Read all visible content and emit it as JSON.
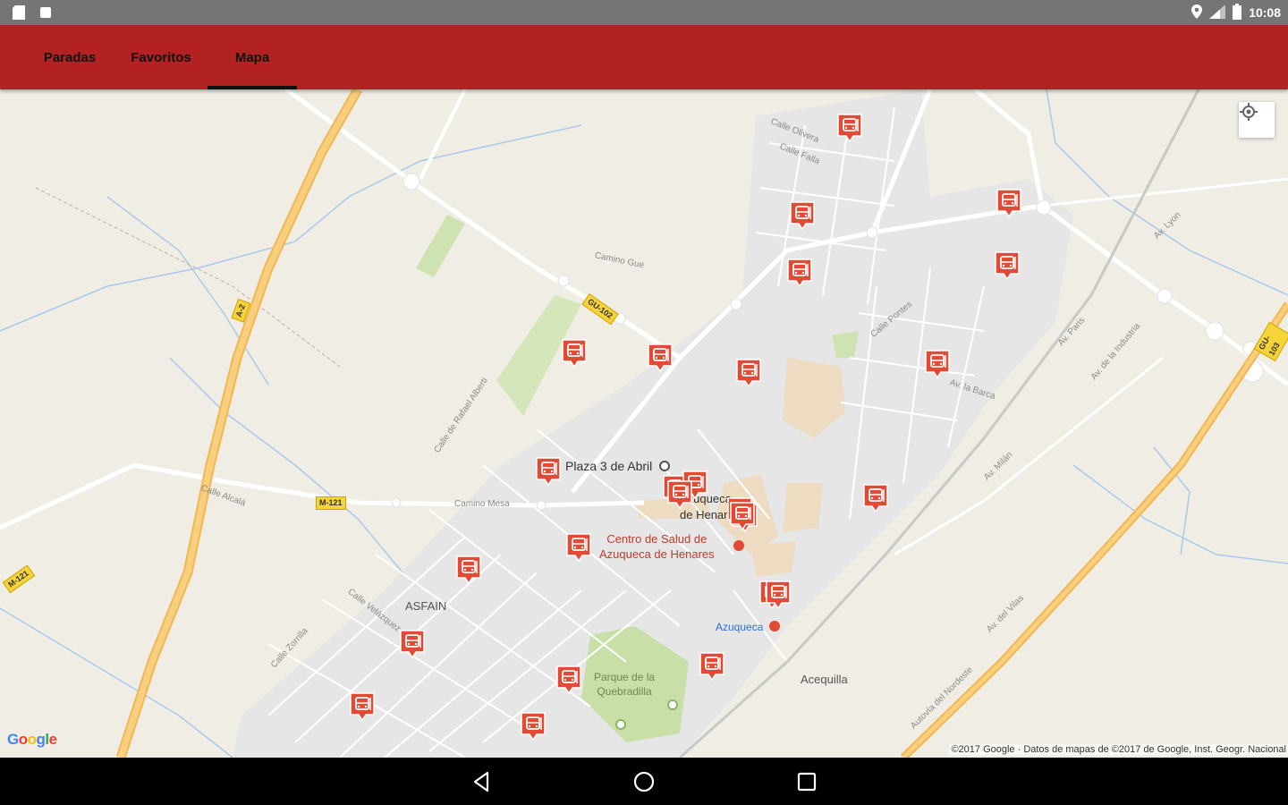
{
  "status_bar": {
    "time": "10:08",
    "left_icons": [
      "sd-card-icon",
      "notification-icon"
    ],
    "right_icons": [
      "location-pin-icon",
      "signal-icon",
      "battery-icon"
    ]
  },
  "tabs": [
    {
      "label": "Paradas",
      "selected": false
    },
    {
      "label": "Favoritos",
      "selected": false
    },
    {
      "label": "Mapa",
      "selected": true
    }
  ],
  "colors": {
    "app_bar": "#b22222",
    "marker": "#e24a33",
    "map_land": "#f0ede5",
    "urban": "#e7e7e7",
    "highway": "#f6c56e"
  },
  "map": {
    "places": {
      "plaza": "Plaza 3 de Abril",
      "partial_label_1": "Azuqueca",
      "partial_label_2": "de Henar",
      "health_center_1": "Centro de Salud de",
      "health_center_2": "Azuqueca de Henares",
      "asfain": "ASFAIN",
      "park_1": "Parque de la",
      "park_2": "Quebradilla",
      "station": "Azuqueca",
      "acequilla": "Acequilla"
    },
    "roads": {
      "calle_oliveros": "Calle Olivera",
      "calle_falla": "Calle Falla",
      "calle_alcala": "Calle Alcalá",
      "camino_mesa": "Camino Mesa",
      "camino_gue": "Camino Gue",
      "calle_rafael_alberti": "Calle de Rafael Alberti",
      "av_la_barca": "Av. la Barca",
      "calle_pontes": "Calle Pontes",
      "av_paris": "Av. Paris",
      "av_industria": "Av. de la Industria",
      "av_lyon": "Av. Lyon",
      "av_milan": "Av. Milán",
      "av_vilas": "Av. del Vilas",
      "autovia": "Autovía del Nordeste",
      "calle_velazquez": "Calle Velázquez",
      "calle_zorilla": "Calle Zorrilla"
    },
    "shields": [
      "M-121",
      "A-2",
      "GU-102",
      "GU-103",
      "M-121"
    ],
    "stop_marker_count": 26
  },
  "google_logo": "Google",
  "attribution": "©2017 Google · Datos de mapas de ©2017 de Google, Inst. Geogr. Nacional",
  "nav": {
    "back": "back-icon",
    "home": "home-icon",
    "recents": "recents-icon"
  }
}
